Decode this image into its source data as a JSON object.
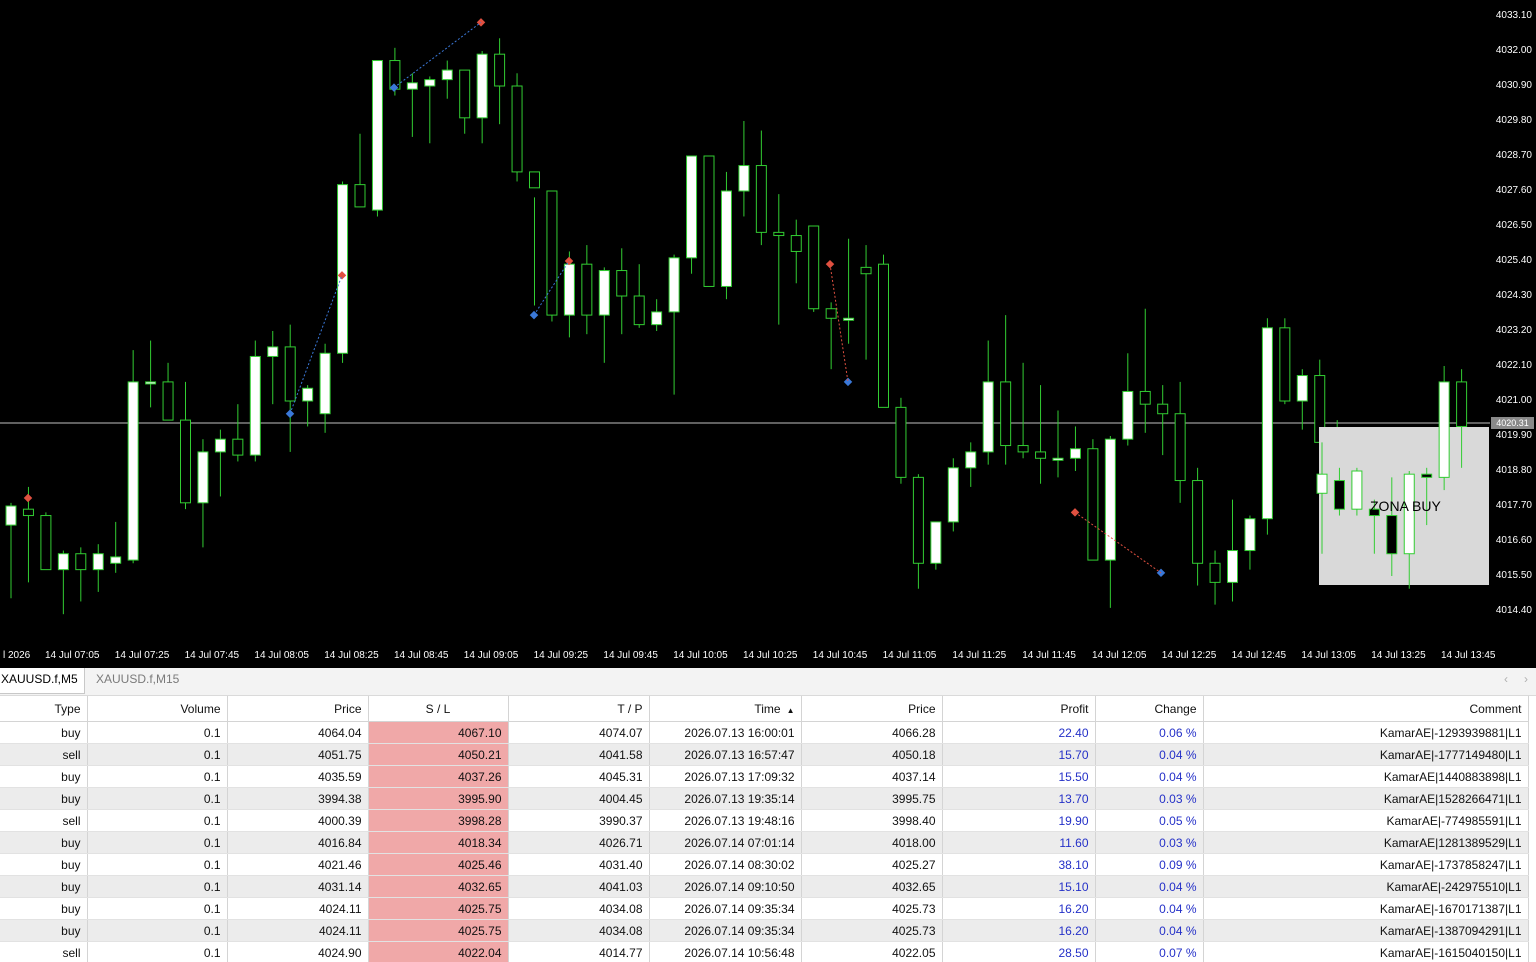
{
  "chart": {
    "price_axis": [
      "4033.10",
      "4032.00",
      "4030.90",
      "4029.80",
      "4028.70",
      "4027.60",
      "4026.50",
      "4025.40",
      "4024.30",
      "4023.20",
      "4022.10",
      "4021.00",
      "4019.90",
      "4018.80",
      "4017.70",
      "4016.60",
      "4015.50",
      "4014.40"
    ],
    "time_axis": [
      "l 2026",
      "14 Jul 07:05",
      "14 Jul 07:25",
      "14 Jul 07:45",
      "14 Jul 08:05",
      "14 Jul 08:25",
      "14 Jul 08:45",
      "14 Jul 09:05",
      "14 Jul 09:25",
      "14 Jul 09:45",
      "14 Jul 10:05",
      "14 Jul 10:25",
      "14 Jul 10:45",
      "14 Jul 11:05",
      "14 Jul 11:25",
      "14 Jul 11:45",
      "14 Jul 12:05",
      "14 Jul 12:25",
      "14 Jul 12:45",
      "14 Jul 13:05",
      "14 Jul 13:25",
      "14 Jul 13:45"
    ],
    "current_price": "4020.31",
    "zone_label": "ZONA BUY",
    "colors": {
      "background": "#000000",
      "wick": "#32cd32",
      "bull_body": "#ffffff",
      "bear_body": "#000000",
      "price_line": "#c0c0c0",
      "zone": "#d9d9d9",
      "sell_marker": "#e05040",
      "buy_marker": "#3a78d8"
    },
    "candles": [
      {
        "o": 4017.1,
        "h": 4017.8,
        "l": 4014.8,
        "c": 4017.7
      },
      {
        "o": 4017.6,
        "h": 4018.3,
        "l": 4015.3,
        "c": 4017.4
      },
      {
        "o": 4017.4,
        "h": 4017.5,
        "l": 4015.7,
        "c": 4015.7
      },
      {
        "o": 4015.7,
        "h": 4016.3,
        "l": 4014.3,
        "c": 4016.2
      },
      {
        "o": 4016.2,
        "h": 4016.4,
        "l": 4014.7,
        "c": 4015.7
      },
      {
        "o": 4015.7,
        "h": 4016.5,
        "l": 4015.0,
        "c": 4016.2
      },
      {
        "o": 4015.9,
        "h": 4017.2,
        "l": 4015.6,
        "c": 4016.1
      },
      {
        "o": 4016.0,
        "h": 4022.6,
        "l": 4015.9,
        "c": 4021.6
      },
      {
        "o": 4021.6,
        "h": 4022.9,
        "l": 4020.8,
        "c": 4021.6
      },
      {
        "o": 4021.6,
        "h": 4022.2,
        "l": 4020.4,
        "c": 4020.4
      },
      {
        "o": 4020.4,
        "h": 4021.6,
        "l": 4017.6,
        "c": 4017.8
      },
      {
        "o": 4017.8,
        "h": 4019.8,
        "l": 4016.4,
        "c": 4019.4
      },
      {
        "o": 4019.4,
        "h": 4020.1,
        "l": 4018.0,
        "c": 4019.8
      },
      {
        "o": 4019.8,
        "h": 4020.9,
        "l": 4019.1,
        "c": 4019.3
      },
      {
        "o": 4019.3,
        "h": 4022.9,
        "l": 4019.1,
        "c": 4022.4
      },
      {
        "o": 4022.4,
        "h": 4023.2,
        "l": 4020.9,
        "c": 4022.7
      },
      {
        "o": 4022.7,
        "h": 4023.4,
        "l": 4019.4,
        "c": 4021.0
      },
      {
        "o": 4021.0,
        "h": 4021.5,
        "l": 4020.2,
        "c": 4021.4
      },
      {
        "o": 4020.6,
        "h": 4022.8,
        "l": 4020.0,
        "c": 4022.5
      },
      {
        "o": 4022.5,
        "h": 4027.9,
        "l": 4022.2,
        "c": 4027.8
      },
      {
        "o": 4027.8,
        "h": 4029.4,
        "l": 4027.3,
        "c": 4027.1
      },
      {
        "o": 4027.0,
        "h": 4031.7,
        "l": 4026.8,
        "c": 4031.7
      },
      {
        "o": 4031.7,
        "h": 4032.1,
        "l": 4030.6,
        "c": 4030.8
      },
      {
        "o": 4030.8,
        "h": 4031.3,
        "l": 4029.3,
        "c": 4031.0
      },
      {
        "o": 4030.9,
        "h": 4031.2,
        "l": 4029.1,
        "c": 4031.1
      },
      {
        "o": 4031.1,
        "h": 4031.7,
        "l": 4030.5,
        "c": 4031.4
      },
      {
        "o": 4031.4,
        "h": 4031.1,
        "l": 4029.4,
        "c": 4029.9
      },
      {
        "o": 4029.9,
        "h": 4032.0,
        "l": 4029.1,
        "c": 4031.9
      },
      {
        "o": 4031.9,
        "h": 4032.4,
        "l": 4029.7,
        "c": 4030.9
      },
      {
        "o": 4030.9,
        "h": 4031.3,
        "l": 4027.9,
        "c": 4028.2
      },
      {
        "o": 4028.2,
        "h": 4027.4,
        "l": 4024.0,
        "c": 4027.7
      },
      {
        "o": 4027.6,
        "h": 4027.6,
        "l": 4023.5,
        "c": 4023.7
      },
      {
        "o": 4023.7,
        "h": 4025.7,
        "l": 4023.0,
        "c": 4025.3
      },
      {
        "o": 4025.3,
        "h": 4025.9,
        "l": 4023.1,
        "c": 4023.7
      },
      {
        "o": 4023.7,
        "h": 4025.2,
        "l": 4022.2,
        "c": 4025.1
      },
      {
        "o": 4025.1,
        "h": 4025.8,
        "l": 4023.1,
        "c": 4024.3
      },
      {
        "o": 4024.3,
        "h": 4025.3,
        "l": 4023.3,
        "c": 4023.4
      },
      {
        "o": 4023.4,
        "h": 4024.2,
        "l": 4023.2,
        "c": 4023.8
      },
      {
        "o": 4023.8,
        "h": 4025.6,
        "l": 4021.2,
        "c": 4025.5
      },
      {
        "o": 4025.5,
        "h": 4026.5,
        "l": 4025.0,
        "c": 4028.7
      },
      {
        "o": 4028.7,
        "h": 4028.7,
        "l": 4024.7,
        "c": 4024.6
      },
      {
        "o": 4024.6,
        "h": 4028.2,
        "l": 4024.2,
        "c": 4027.6
      },
      {
        "o": 4027.6,
        "h": 4029.8,
        "l": 4026.8,
        "c": 4028.4
      },
      {
        "o": 4028.4,
        "h": 4029.5,
        "l": 4025.9,
        "c": 4026.3
      },
      {
        "o": 4026.3,
        "h": 4027.5,
        "l": 4023.4,
        "c": 4026.2
      },
      {
        "o": 4026.2,
        "h": 4026.7,
        "l": 4024.7,
        "c": 4025.7
      },
      {
        "o": 4026.5,
        "h": 4026.5,
        "l": 4023.8,
        "c": 4023.9
      },
      {
        "o": 4023.9,
        "h": 4024.1,
        "l": 4022.0,
        "c": 4023.6
      },
      {
        "o": 4023.6,
        "h": 4026.1,
        "l": 4022.8,
        "c": 4023.6
      },
      {
        "o": 4025.2,
        "h": 4025.9,
        "l": 4022.3,
        "c": 4025.0
      },
      {
        "o": 4025.3,
        "h": 4025.6,
        "l": 4020.8,
        "c": 4020.8
      },
      {
        "o": 4020.8,
        "h": 4021.1,
        "l": 4018.4,
        "c": 4018.6
      },
      {
        "o": 4018.6,
        "h": 4018.7,
        "l": 4015.1,
        "c": 4015.9
      },
      {
        "o": 4015.9,
        "h": 4017.2,
        "l": 4015.7,
        "c": 4017.2
      },
      {
        "o": 4017.2,
        "h": 4019.2,
        "l": 4016.9,
        "c": 4018.9
      },
      {
        "o": 4018.9,
        "h": 4019.7,
        "l": 4018.3,
        "c": 4019.4
      },
      {
        "o": 4019.4,
        "h": 4022.9,
        "l": 4019.0,
        "c": 4021.6
      },
      {
        "o": 4021.6,
        "h": 4023.7,
        "l": 4019.0,
        "c": 4019.6
      },
      {
        "o": 4019.6,
        "h": 4022.2,
        "l": 4019.2,
        "c": 4019.4
      },
      {
        "o": 4019.4,
        "h": 4021.5,
        "l": 4018.4,
        "c": 4019.2
      },
      {
        "o": 4019.2,
        "h": 4020.7,
        "l": 4018.6,
        "c": 4019.2
      },
      {
        "o": 4019.2,
        "h": 4020.2,
        "l": 4018.8,
        "c": 4019.5
      },
      {
        "o": 4019.5,
        "h": 4019.8,
        "l": 4016.0,
        "c": 4016.0
      },
      {
        "o": 4016.0,
        "h": 4019.9,
        "l": 4014.5,
        "c": 4019.8
      },
      {
        "o": 4019.8,
        "h": 4022.5,
        "l": 4019.6,
        "c": 4021.3
      },
      {
        "o": 4021.3,
        "h": 4023.9,
        "l": 4020.0,
        "c": 4020.9
      },
      {
        "o": 4020.9,
        "h": 4021.5,
        "l": 4019.3,
        "c": 4020.6
      },
      {
        "o": 4020.6,
        "h": 4021.6,
        "l": 4017.8,
        "c": 4018.5
      },
      {
        "o": 4018.5,
        "h": 4018.9,
        "l": 4015.2,
        "c": 4015.9
      },
      {
        "o": 4015.9,
        "h": 4016.3,
        "l": 4014.6,
        "c": 4015.3
      },
      {
        "o": 4015.3,
        "h": 4017.9,
        "l": 4014.7,
        "c": 4016.3
      },
      {
        "o": 4016.3,
        "h": 4017.4,
        "l": 4015.7,
        "c": 4017.3
      },
      {
        "o": 4017.3,
        "h": 4023.6,
        "l": 4016.8,
        "c": 4023.3
      },
      {
        "o": 4023.3,
        "h": 4023.6,
        "l": 4020.9,
        "c": 4021.0
      },
      {
        "o": 4021.0,
        "h": 4022.0,
        "l": 4020.1,
        "c": 4021.8
      },
      {
        "o": 4021.8,
        "h": 4022.3,
        "l": 4019.8,
        "c": 4019.7
      },
      {
        "o": 4019.7,
        "h": 4020.4,
        "l": 4018.6,
        "c": 4018.1
      },
      {
        "o": 4018.1,
        "h": 4018.6,
        "l": 4017.8,
        "c": 4017.9
      }
    ],
    "zone_candles": [
      {
        "o": 4018.1,
        "h": 4019.7,
        "l": 4016.2,
        "c": 4018.7
      },
      {
        "o": 4018.5,
        "h": 4018.9,
        "l": 4017.4,
        "c": 4017.6
      },
      {
        "o": 4017.6,
        "h": 4018.9,
        "l": 4017.4,
        "c": 4018.8
      },
      {
        "o": 4017.6,
        "h": 4017.9,
        "l": 4016.2,
        "c": 4017.4
      },
      {
        "o": 4017.4,
        "h": 4018.6,
        "l": 4015.5,
        "c": 4016.2
      },
      {
        "o": 4016.2,
        "h": 4018.8,
        "l": 4015.1,
        "c": 4018.7
      },
      {
        "o": 4018.7,
        "h": 4018.9,
        "l": 4017.1,
        "c": 4018.6
      },
      {
        "o": 4018.6,
        "h": 4022.1,
        "l": 4018.2,
        "c": 4021.6
      },
      {
        "o": 4021.6,
        "h": 4022.0,
        "l": 4018.9,
        "c": 4020.2
      }
    ]
  },
  "tabs": [
    "XAUUSD.f,M5",
    "XAUUSD.f,M15"
  ],
  "table": {
    "headers": [
      "Type",
      "Volume",
      "Price",
      "S / L",
      "T / P",
      "Time",
      "Price",
      "Profit",
      "Change",
      "Comment"
    ],
    "rows": [
      [
        "buy",
        "0.1",
        "4064.04",
        "4067.10",
        "4074.07",
        "2026.07.13 16:00:01",
        "4066.28",
        "22.40",
        "0.06 %",
        "KamarAE|-1293939881|L1"
      ],
      [
        "sell",
        "0.1",
        "4051.75",
        "4050.21",
        "4041.58",
        "2026.07.13 16:57:47",
        "4050.18",
        "15.70",
        "0.04 %",
        "KamarAE|-1777149480|L1"
      ],
      [
        "buy",
        "0.1",
        "4035.59",
        "4037.26",
        "4045.31",
        "2026.07.13 17:09:32",
        "4037.14",
        "15.50",
        "0.04 %",
        "KamarAE|1440883898|L1"
      ],
      [
        "buy",
        "0.1",
        "3994.38",
        "3995.90",
        "4004.45",
        "2026.07.13 19:35:14",
        "3995.75",
        "13.70",
        "0.03 %",
        "KamarAE|1528266471|L1"
      ],
      [
        "sell",
        "0.1",
        "4000.39",
        "3998.28",
        "3990.37",
        "2026.07.13 19:48:16",
        "3998.40",
        "19.90",
        "0.05 %",
        "KamarAE|-774985591|L1"
      ],
      [
        "buy",
        "0.1",
        "4016.84",
        "4018.34",
        "4026.71",
        "2026.07.14 07:01:14",
        "4018.00",
        "11.60",
        "0.03 %",
        "KamarAE|1281389529|L1"
      ],
      [
        "buy",
        "0.1",
        "4021.46",
        "4025.46",
        "4031.40",
        "2026.07.14 08:30:02",
        "4025.27",
        "38.10",
        "0.09 %",
        "KamarAE|-1737858247|L1"
      ],
      [
        "buy",
        "0.1",
        "4031.14",
        "4032.65",
        "4041.03",
        "2026.07.14 09:10:50",
        "4032.65",
        "15.10",
        "0.04 %",
        "KamarAE|-242975510|L1"
      ],
      [
        "buy",
        "0.1",
        "4024.11",
        "4025.75",
        "4034.08",
        "2026.07.14 09:35:34",
        "4025.73",
        "16.20",
        "0.04 %",
        "KamarAE|-1670171387|L1"
      ],
      [
        "buy",
        "0.1",
        "4024.11",
        "4025.75",
        "4034.08",
        "2026.07.14 09:35:34",
        "4025.73",
        "16.20",
        "0.04 %",
        "KamarAE|-1387094291|L1"
      ],
      [
        "sell",
        "0.1",
        "4024.90",
        "4022.04",
        "4014.77",
        "2026.07.14 10:56:48",
        "4022.05",
        "28.50",
        "0.07 %",
        "KamarAE|-1615040150|L1"
      ]
    ]
  }
}
